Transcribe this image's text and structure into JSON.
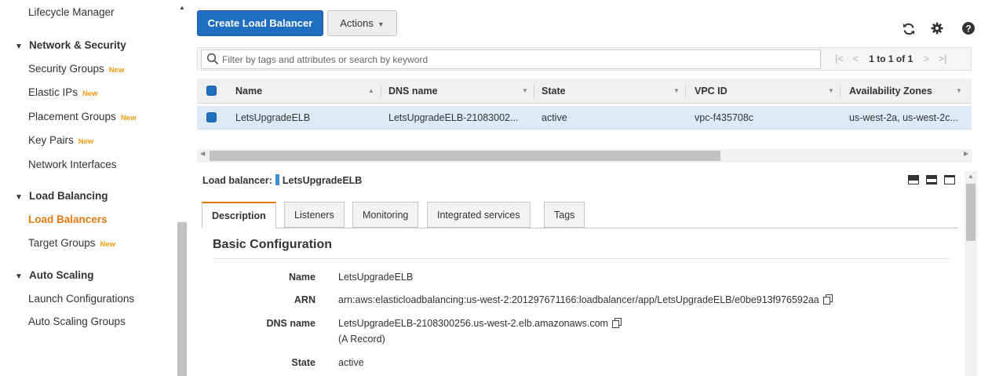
{
  "sidebar": {
    "items": [
      {
        "label": "Lifecycle Manager"
      },
      {
        "heading": "Network & Security"
      },
      {
        "label": "Security Groups",
        "badge": "New"
      },
      {
        "label": "Elastic IPs",
        "badge": "New"
      },
      {
        "label": "Placement Groups",
        "badge": "New"
      },
      {
        "label": "Key Pairs",
        "badge": "New"
      },
      {
        "label": "Network Interfaces"
      },
      {
        "heading": "Load Balancing"
      },
      {
        "label": "Load Balancers"
      },
      {
        "label": "Target Groups",
        "badge": "New"
      },
      {
        "heading": "Auto Scaling"
      },
      {
        "label": "Launch Configurations"
      },
      {
        "label": "Auto Scaling Groups"
      }
    ],
    "active_item": "Load Balancers",
    "heading_glyph": "▼"
  },
  "toolbar": {
    "create_label": "Create Load Balancer",
    "actions_label": "Actions",
    "icons": [
      "refresh-icon",
      "gear-icon",
      "help-icon"
    ]
  },
  "filter": {
    "placeholder": "Filter by tags and attributes or search by keyword",
    "pager_text": "1 to 1 of 1"
  },
  "table": {
    "columns": [
      "Name",
      "DNS name",
      "State",
      "VPC ID",
      "Availability Zones"
    ],
    "rows": [
      {
        "name": "LetsUpgradeELB",
        "dns": "LetsUpgradeELB-21083002...",
        "state": "active",
        "vpc": "vpc-f435708c",
        "az": "us-west-2a, us-west-2c..."
      }
    ]
  },
  "details": {
    "label": "Load balancer:",
    "name": "LetsUpgradeELB",
    "tabs": [
      "Description",
      "Listeners",
      "Monitoring",
      "Integrated services",
      "Tags"
    ],
    "active_tab": "Description",
    "section_title": "Basic Configuration",
    "fields": [
      {
        "key": "Name",
        "value": "LetsUpgradeELB"
      },
      {
        "key": "ARN",
        "value": "arn:aws:elasticloadbalancing:us-west-2:201297671166:loadbalancer/app/LetsUpgradeELB/e0be913f976592aa"
      },
      {
        "key": "DNS name",
        "value": "LetsUpgradeELB-2108300256.us-west-2.elb.amazonaws.com",
        "note": "(A Record)"
      },
      {
        "key": "State",
        "value": "active"
      }
    ]
  },
  "colors": {
    "primary_button": "#1f6ebf",
    "active_nav": "#e47911",
    "badge_new": "#f29b0c",
    "selected_row": "#ddeaf7"
  }
}
